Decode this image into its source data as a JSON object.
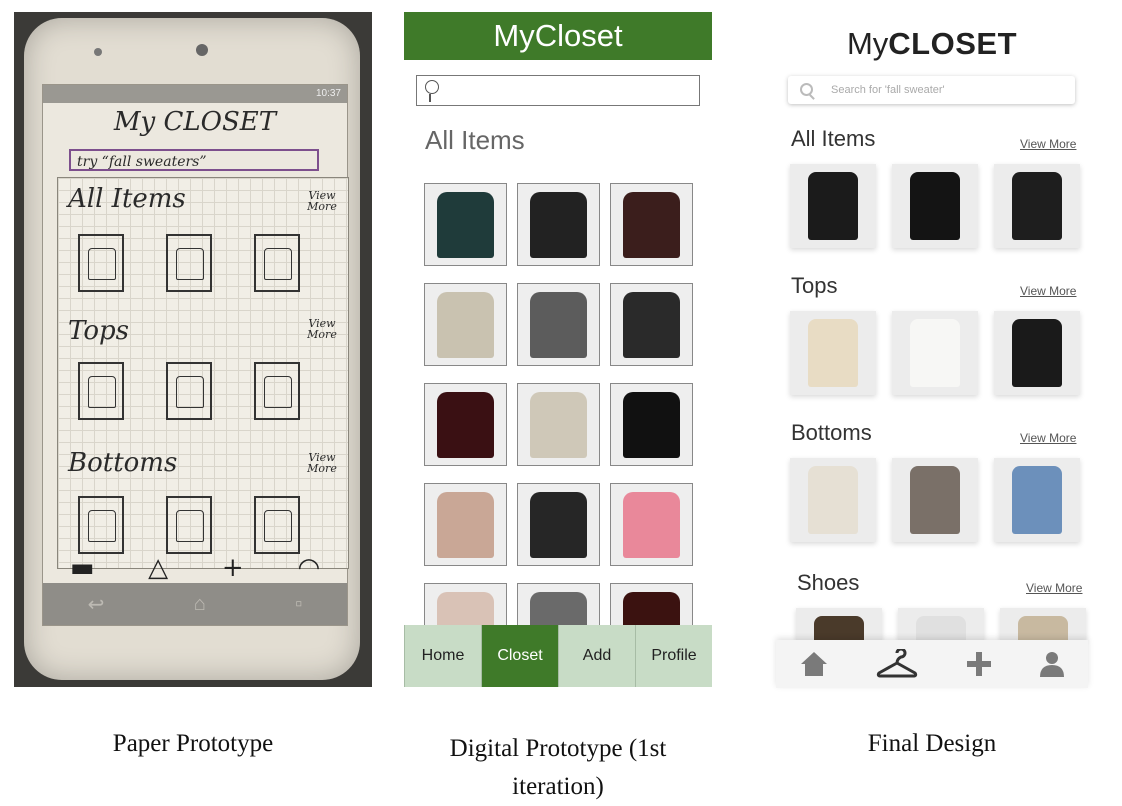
{
  "paper": {
    "status_time": "10:37",
    "title": "My CLOSET",
    "search_text": "try “fall sweaters”",
    "sections": [
      {
        "title": "All Items",
        "more": "View More"
      },
      {
        "title": "Tops",
        "more": "View More"
      },
      {
        "title": "Bottoms",
        "more": "View More"
      }
    ],
    "nav": {
      "home": "▬",
      "closet": "△",
      "add": "+",
      "profile": "◠"
    }
  },
  "digital": {
    "header": "MyCloset",
    "section_title": "All Items",
    "nav": [
      {
        "label": "Home",
        "active": false
      },
      {
        "label": "Closet",
        "active": true
      },
      {
        "label": "Add",
        "active": false
      },
      {
        "label": "Profile",
        "active": false
      }
    ],
    "tile_colors": [
      "#1f3b3a",
      "#222222",
      "#3b1e1c",
      "#c9c2b0",
      "#5c5c5c",
      "#2a2a2a",
      "#3a1013",
      "#cfc8b8",
      "#111111",
      "#c9a796",
      "#262626",
      "#e9889a",
      "#d9c2b6",
      "#6a6a6a",
      "#3b1210"
    ],
    "colors": {
      "header": "#3f7a29",
      "nav": "#c8dcc6"
    }
  },
  "final": {
    "title_my": "My",
    "title_closet": "CLOSET",
    "search_placeholder": "Search for 'fall sweater'",
    "sections": [
      {
        "title": "All Items",
        "more": "View More",
        "colors": [
          "#1b1b1b",
          "#141414",
          "#1e1e1e"
        ]
      },
      {
        "title": "Tops",
        "more": "View More",
        "colors": [
          "#e8dcc4",
          "#f7f7f5",
          "#1a1a1a"
        ]
      },
      {
        "title": "Bottoms",
        "more": "View More",
        "colors": [
          "#e6e0d4",
          "#7a7068",
          "#6c90bb"
        ]
      },
      {
        "title": "Shoes",
        "more": "View More",
        "colors": [
          "#4a3a2a",
          "#e0e0e0",
          "#c8b9a0"
        ]
      }
    ],
    "nav_icons": [
      "home-icon",
      "hanger-icon",
      "plus-icon",
      "user-icon"
    ]
  },
  "captions": {
    "paper": "Paper Prototype",
    "digital": "Digital Prototype (1st iteration)",
    "final": "Final Design"
  }
}
